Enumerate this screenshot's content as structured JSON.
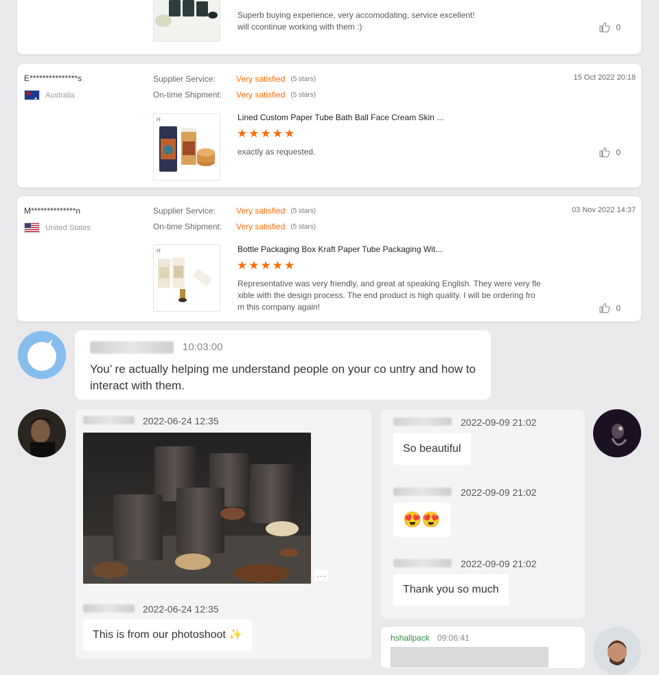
{
  "reviews": [
    {
      "comment": "Superb buying experience, very accomodating, service excellent!\nwill ccontinue working with them :)",
      "likes": "0"
    },
    {
      "reviewer": "E***************s",
      "country": "Australia",
      "supplier_label": "Supplier Service:",
      "supplier_value": "Very satisfied",
      "supplier_stars": "(5 stars)",
      "shipment_label": "On-time Shipment:",
      "shipment_value": "Very satisfied",
      "shipment_stars": "(5 stars)",
      "date": "15 Oct 2022 20:18",
      "product_title": "Lined Custom Paper Tube Bath Ball Face Cream Skin ...",
      "stars": "★★★★★",
      "comment": "exactly as requested.",
      "likes": "0"
    },
    {
      "reviewer": "M**************n",
      "country": "United States",
      "supplier_label": "Supplier Service:",
      "supplier_value": "Very satisfied",
      "supplier_stars": "(5 stars)",
      "shipment_label": "On-time Shipment:",
      "shipment_value": "Very satisfied",
      "shipment_stars": "(5 stars)",
      "date": "03 Nov 2022 14:37",
      "product_title": "Bottle Packaging Box Kraft Paper Tube Packaging Wit...",
      "stars": "★★★★★",
      "comment": "Representative was very friendly, and great at speaking English. They were very fle\nxible with the design process. The end product is high quality. I will be ordering fro\nm this company again!",
      "likes": "0"
    }
  ],
  "chat1": {
    "time": "10:03:00",
    "message": "You’ re actually helping me understand people on your co untry and how to interact with them."
  },
  "chat_left": {
    "msg1_time": "2022-06-24 12:35",
    "msg2_time": "2022-06-24 12:35",
    "msg2_text": "This is from our photoshoot ✨",
    "more": "···"
  },
  "chat_right": {
    "msgs": [
      {
        "time": "2022-09-09 21:02",
        "text": "So beautiful"
      },
      {
        "time": "2022-09-09 21:02",
        "text": "😍😍"
      },
      {
        "time": "2022-09-09 21:02",
        "text": "Thank you so much"
      }
    ]
  },
  "chat_bottom": {
    "name": "hshallpack",
    "time": "09:06:41"
  },
  "colors": {
    "accent_orange": "#ff6a00",
    "bg": "#e9e9eb",
    "chat_name_green": "#2e8b3e"
  }
}
